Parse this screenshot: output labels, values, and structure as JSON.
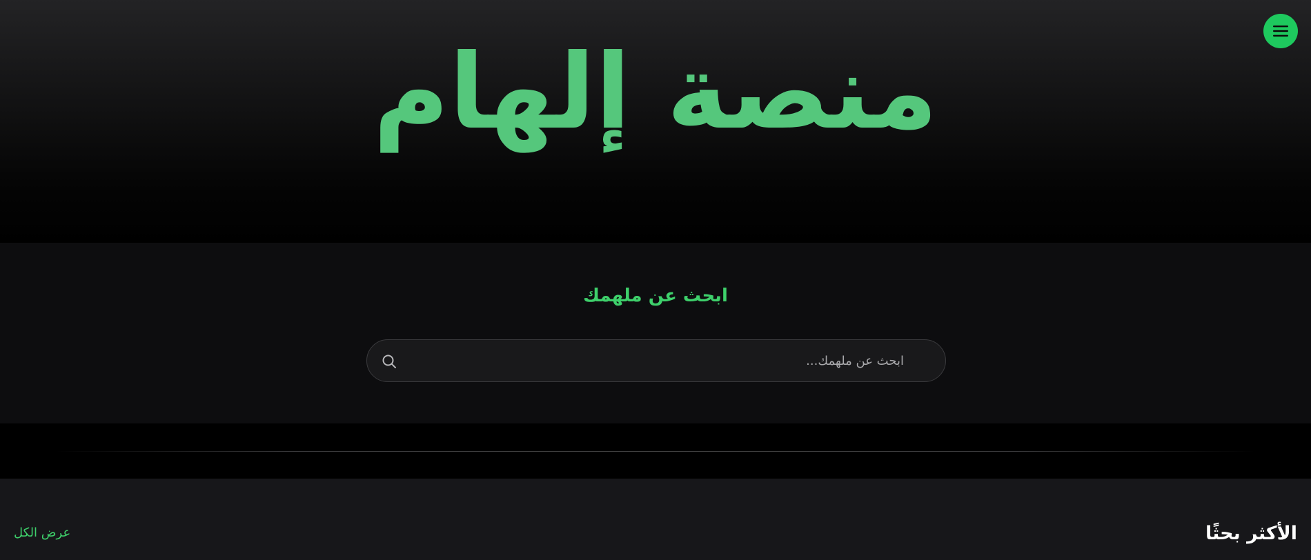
{
  "header": {
    "logo_title": "منصة إلهام",
    "menu_icon": "hamburger-menu-icon"
  },
  "search": {
    "heading": "ابحث عن ملهمك",
    "placeholder": "ابحث عن ملهمك...",
    "value": "",
    "icon": "search-icon"
  },
  "most_searched": {
    "title": "الأكثر بحثًا",
    "view_all_label": "عرض الكل"
  },
  "colors": {
    "brand_green": "#55c77c",
    "accent_green": "#3ed06b",
    "menu_button": "#1ec95e",
    "background": "#000000"
  }
}
